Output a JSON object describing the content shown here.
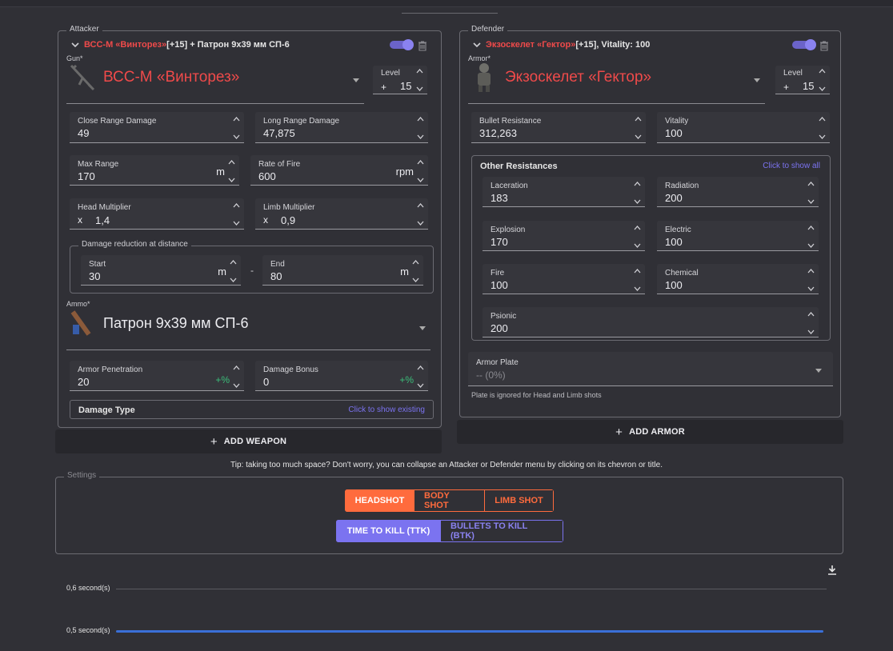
{
  "attacker": {
    "legend": "Attacker",
    "title_name": "ВСС-М «Винторез»",
    "title_rest": " [+15] + Патрон 9x39 мм СП-6",
    "gun_label": "Gun*",
    "gun_name": "ВСС-М «Винторез»",
    "level_label": "Level",
    "level_prefix": "+",
    "level_value": "15",
    "fields": {
      "close_range": {
        "label": "Close Range Damage",
        "value": "49"
      },
      "long_range": {
        "label": "Long Range Damage",
        "value": "47,875"
      },
      "max_range": {
        "label": "Max Range",
        "value": "170",
        "unit": "m"
      },
      "rate_of_fire": {
        "label": "Rate of Fire",
        "value": "600",
        "unit": "rpm"
      },
      "head_mult": {
        "label": "Head Multiplier",
        "prefix": "x",
        "value": "1,4"
      },
      "limb_mult": {
        "label": "Limb Multiplier",
        "prefix": "x",
        "value": "0,9"
      }
    },
    "dmg_reduction": {
      "legend": "Damage reduction at distance",
      "start_label": "Start",
      "start_value": "30",
      "start_unit": "m",
      "separator": "-",
      "end_label": "End",
      "end_value": "80",
      "end_unit": "m"
    },
    "ammo_label": "Ammo*",
    "ammo_name": "Патрон 9x39 мм СП-6",
    "armor_pen": {
      "label": "Armor Penetration",
      "value": "20",
      "unit": "+%"
    },
    "damage_bonus": {
      "label": "Damage Bonus",
      "value": "0",
      "unit": "+%"
    },
    "damage_type_title": "Damage Type",
    "damage_type_link": "Click to show existing",
    "add_button": "ADD WEAPON"
  },
  "defender": {
    "legend": "Defender",
    "title_name": "Экзоскелет «Гектор»",
    "title_rest": " [+15], Vitality: 100",
    "armor_label": "Armor*",
    "armor_name": "Экзоскелет «Гектор»",
    "level_label": "Level",
    "level_prefix": "+",
    "level_value": "15",
    "bullet_res": {
      "label": "Bullet Resistance",
      "value": "312,263"
    },
    "vitality": {
      "label": "Vitality",
      "value": "100"
    },
    "other_title": "Other Resistances",
    "other_link": "Click to show all",
    "laceration": {
      "label": "Laceration",
      "value": "183"
    },
    "radiation": {
      "label": "Radiation",
      "value": "200"
    },
    "explosion": {
      "label": "Explosion",
      "value": "170"
    },
    "electric": {
      "label": "Electric",
      "value": "100"
    },
    "fire": {
      "label": "Fire",
      "value": "100"
    },
    "chemical": {
      "label": "Chemical",
      "value": "100"
    },
    "psionic": {
      "label": "Psionic",
      "value": "200"
    },
    "plate_label": "Armor Plate",
    "plate_value": "-- (0%)",
    "plate_hint": "Plate is ignored for Head and Limb shots",
    "add_button": "ADD ARMOR"
  },
  "tip": "Tip: taking too much space? Don't worry, you can collapse an Attacker or Defender menu by clicking on its chevron or title.",
  "settings": {
    "legend": "Settings",
    "shot_buttons": [
      "HEADSHOT",
      "BODY SHOT",
      "LIMB SHOT"
    ],
    "mode_buttons": [
      "TIME TO KILL (TTK)",
      "BULLETS TO KILL (BTK)"
    ]
  },
  "chart_data": {
    "type": "bar",
    "orientation": "horizontal",
    "tick_labels": [
      "0,6 second(s)",
      "0,5 second(s)"
    ],
    "series": [
      {
        "values": [
          0.5
        ]
      }
    ],
    "bar_color": "#3a6fd8"
  },
  "colors": {
    "accent_red": "#ef4a4a",
    "accent_orange": "#ff6b3d",
    "accent_purple": "#7b73f0",
    "accent_green": "#3bbf7a"
  }
}
